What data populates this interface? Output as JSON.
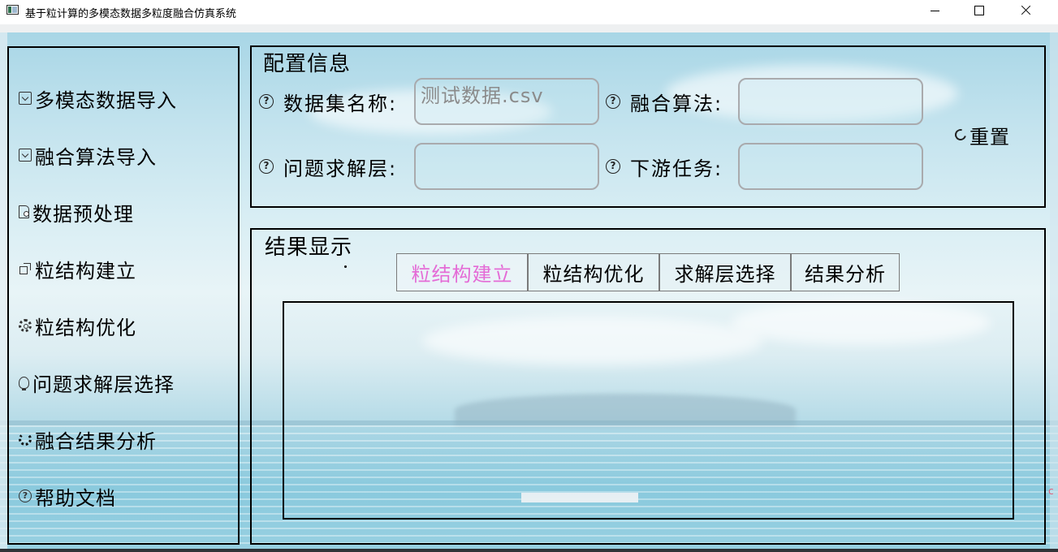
{
  "window": {
    "title": "基于粒计算的多模态数据多粒度融合仿真系统"
  },
  "sidebar": {
    "items": [
      {
        "label": "多模态数据导入",
        "icon": "import-icon"
      },
      {
        "label": "融合算法导入",
        "icon": "import-icon"
      },
      {
        "label": "数据预处理",
        "icon": "document-settings-icon"
      },
      {
        "label": "粒结构建立",
        "icon": "structure-icon"
      },
      {
        "label": "粒结构优化",
        "icon": "gear-icon"
      },
      {
        "label": "问题求解层选择",
        "icon": "lightbulb-icon"
      },
      {
        "label": "融合结果分析",
        "icon": "spinner-icon"
      },
      {
        "label": "帮助文档",
        "icon": "help-icon"
      }
    ]
  },
  "config": {
    "title": "配置信息",
    "dataset_label": "数据集名称:",
    "dataset_value": "测试数据.csv",
    "algorithm_label": "融合算法:",
    "algorithm_value": "",
    "layer_label": "问题求解层:",
    "layer_value": "",
    "task_label": "下游任务:",
    "task_value": "",
    "reset_label": "重置"
  },
  "results": {
    "title": "结果显示",
    "tabs": [
      {
        "label": "粒结构建立",
        "active": true
      },
      {
        "label": "粒结构优化",
        "active": false
      },
      {
        "label": "求解层选择",
        "active": false
      },
      {
        "label": "结果分析",
        "active": false
      }
    ]
  },
  "colors": {
    "active_tab": "#e46bd6",
    "border": "#000000",
    "input_border": "#a9aaad"
  }
}
